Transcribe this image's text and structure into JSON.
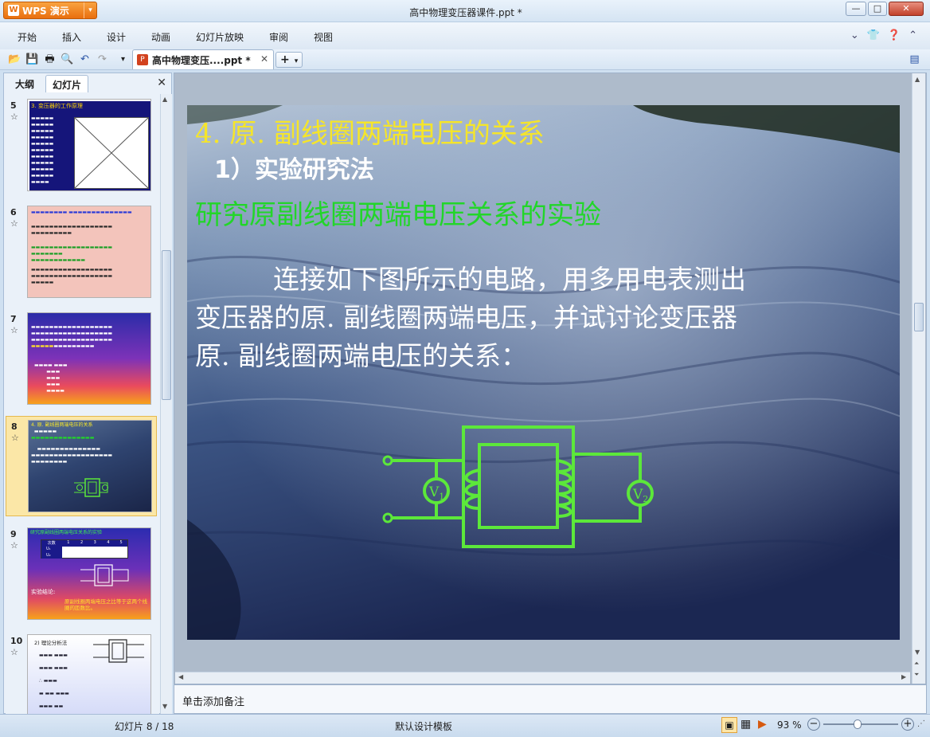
{
  "app": {
    "name": "WPS 演示",
    "title": "高中物理变压器课件.ppt *"
  },
  "menu": [
    "开始",
    "插入",
    "设计",
    "动画",
    "幻灯片放映",
    "审阅",
    "视图"
  ],
  "doc_tab": {
    "label": "高中物理变压....ppt *"
  },
  "left_pane": {
    "tabs": [
      "大纲",
      "幻灯片"
    ],
    "thumbnails": [
      {
        "num": "5",
        "title": "3. 变压器的工作原理"
      },
      {
        "num": "6"
      },
      {
        "num": "7"
      },
      {
        "num": "8",
        "title": "4. 原. 副线圈两端电压的关系",
        "selected": true
      },
      {
        "num": "9",
        "title": "研究原副线圈两端电压关系的实验",
        "table_headers": [
          "次数",
          "1",
          "2",
          "3",
          "4",
          "5"
        ],
        "rows": [
          "U₁",
          "U₂"
        ],
        "conclusion_label": "实验结论:",
        "conclusion": "原副线圈两端电压之比等于这两个线圈的匝数比。"
      },
      {
        "num": "10",
        "title": "2) 理论分析法"
      }
    ]
  },
  "slide": {
    "title": "4. 原. 副线圈两端电压的关系",
    "subtitle": "1）实验研究法",
    "heading": "研究原副线圈两端电压关系的实验",
    "body_lines": [
      "连接如下图所示的电路，用多用电表测出",
      "变压器的原. 副线圈两端电压，并试讨论变压器",
      "原. 副线圈两端电压的关系："
    ],
    "meter1": "V",
    "meter1_sub": "1",
    "meter2": "V",
    "meter2_sub": "2",
    "colors": {
      "title": "#f5e52a",
      "subtitle": "#ffffff",
      "heading": "#22d629",
      "body": "#ffffff",
      "circuit": "#5ce83a"
    }
  },
  "notes": {
    "placeholder": "单击添加备注"
  },
  "status": {
    "slide_counter": "幻灯片 8 / 18",
    "template": "默认设计模板",
    "zoom": "93 %"
  }
}
